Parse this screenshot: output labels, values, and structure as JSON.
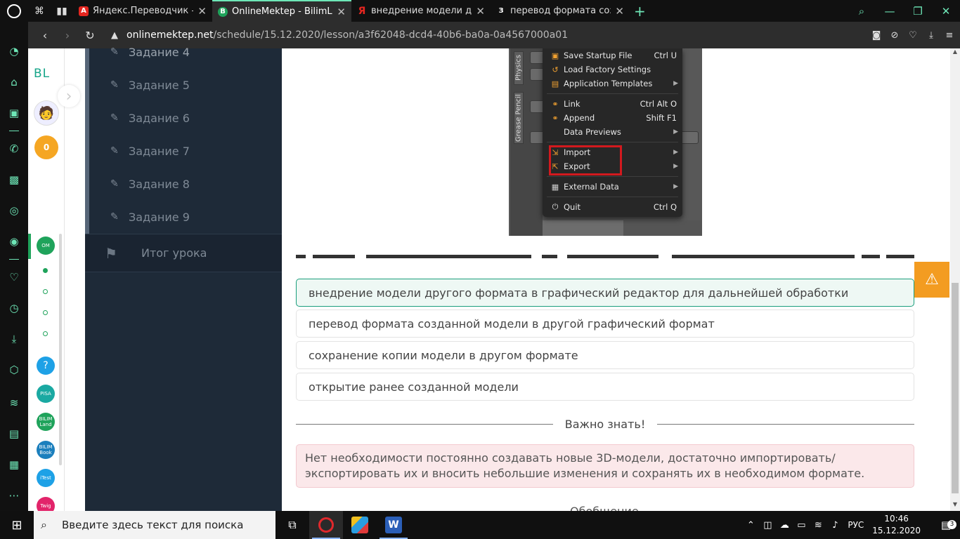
{
  "browser": {
    "tabs": [
      {
        "title": "Яндекс.Переводчик – сло",
        "favicon": "А",
        "active": false
      },
      {
        "title": "OnlineMektep - BilimLand",
        "favicon": "B",
        "active": true
      },
      {
        "title": "внедрение модели другог",
        "favicon": "Я",
        "active": false
      },
      {
        "title": "перевод формата создан",
        "favicon": "З",
        "active": false
      }
    ],
    "url_host": "onlinemektep.net",
    "url_path": "/schedule/15.12.2020/lesson/a3f62048-dcd4-40b6-ba0a-0a4567000a01"
  },
  "site_rail": {
    "logo": "BL",
    "coins": "0",
    "help": "?",
    "apps": [
      "PISA",
      "BILIM Land",
      "BILIM Book",
      "iTest",
      "Twig"
    ]
  },
  "lesson_nav": {
    "tasks": [
      "Задание 4",
      "Задание 5",
      "Задание 6",
      "Задание 7",
      "Задание 8",
      "Задание 9"
    ],
    "summary": "Итог урока"
  },
  "blender_menu": {
    "side_tab_1": "Physics",
    "side_tab_2": "Grease Pencil",
    "items": [
      {
        "label": "Save Startup File",
        "shortcut": "Ctrl U",
        "submenu": false
      },
      {
        "label": "Load Factory Settings",
        "shortcut": "",
        "submenu": false
      },
      {
        "label": "Application Templates",
        "shortcut": "",
        "submenu": true
      },
      {
        "label": "Link",
        "shortcut": "Ctrl Alt O",
        "submenu": false
      },
      {
        "label": "Append",
        "shortcut": "Shift F1",
        "submenu": false
      },
      {
        "label": "Data Previews",
        "shortcut": "",
        "submenu": true
      },
      {
        "label": "Import",
        "shortcut": "",
        "submenu": true
      },
      {
        "label": "Export",
        "shortcut": "",
        "submenu": true
      },
      {
        "label": "External Data",
        "shortcut": "",
        "submenu": true
      },
      {
        "label": "Quit",
        "shortcut": "Ctrl Q",
        "submenu": false
      }
    ]
  },
  "answers": [
    {
      "text": "внедрение модели другого формата в графический редактор для дальнейшей обработки",
      "selected": true
    },
    {
      "text": "перевод формата созданной модели в другой графический формат",
      "selected": false
    },
    {
      "text": "сохранение копии модели в другом формате",
      "selected": false
    },
    {
      "text": "открытие ранее созданной модели",
      "selected": false
    }
  ],
  "important": {
    "title": "Важно знать!",
    "text": "Нет необходимости постоянно создавать новые 3D-модели, достаточно импортировать/экспортировать их и вносить небольшие изменения и сохранять их в необходимом формате."
  },
  "cut_text": "Обобщение",
  "taskbar": {
    "search_placeholder": "Введите здесь текст для поиска",
    "lang": "РУС",
    "time": "10:46",
    "date": "15.12.2020",
    "notifications": "3"
  }
}
